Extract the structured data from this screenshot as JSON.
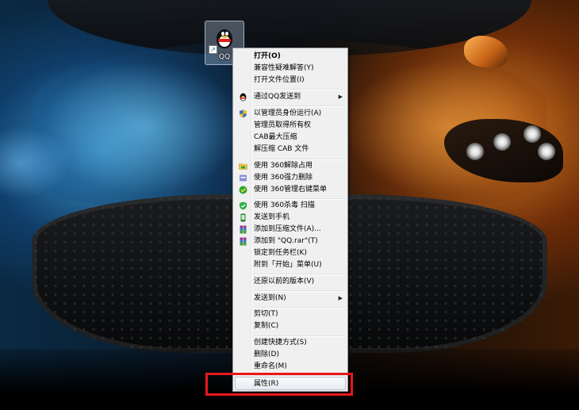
{
  "desktop": {
    "icon_label": "QQ"
  },
  "menu": {
    "items": [
      {
        "label": "打开(O)",
        "icon": "none",
        "bold": true
      },
      {
        "label": "兼容性疑难解答(Y)",
        "icon": "none"
      },
      {
        "label": "打开文件位置(I)",
        "icon": "none"
      },
      {
        "label": "通过QQ发送到",
        "icon": "qq-penguin-icon",
        "submenu": true
      },
      {
        "label": "以管理员身份运行(A)",
        "icon": "uac-shield-icon"
      },
      {
        "label": "管理员取得所有权",
        "icon": "none"
      },
      {
        "label": "CAB最大压缩",
        "icon": "none"
      },
      {
        "label": "解压缩 CAB 文件",
        "icon": "none"
      },
      {
        "label": "使用 360解除占用",
        "icon": "360-folder-icon"
      },
      {
        "label": "使用 360强力删除",
        "icon": "360-shred-icon"
      },
      {
        "label": "使用 360管理右键菜单",
        "icon": "360-menu-icon"
      },
      {
        "label": "使用 360杀毒 扫描",
        "icon": "360-antivirus-icon"
      },
      {
        "label": "发送到手机",
        "icon": "phone-icon"
      },
      {
        "label": "添加到压缩文件(A)...",
        "icon": "winrar-icon"
      },
      {
        "label": "添加到 \"QQ.rar\"(T)",
        "icon": "winrar-icon"
      },
      {
        "label": "锁定到任务栏(K)",
        "icon": "none"
      },
      {
        "label": "附到「开始」菜单(U)",
        "icon": "none"
      },
      {
        "label": "还原以前的版本(V)",
        "icon": "none"
      },
      {
        "label": "发送到(N)",
        "icon": "none",
        "submenu": true
      },
      {
        "label": "剪切(T)",
        "icon": "none"
      },
      {
        "label": "复制(C)",
        "icon": "none"
      },
      {
        "label": "创建快捷方式(S)",
        "icon": "none"
      },
      {
        "label": "删除(D)",
        "icon": "none"
      },
      {
        "label": "重命名(M)",
        "icon": "none"
      },
      {
        "label": "属性(R)",
        "icon": "none",
        "highlighted": true
      }
    ]
  },
  "colors": {
    "menu_bg": "#f0f0f0",
    "highlight_box": "#e8171b"
  }
}
